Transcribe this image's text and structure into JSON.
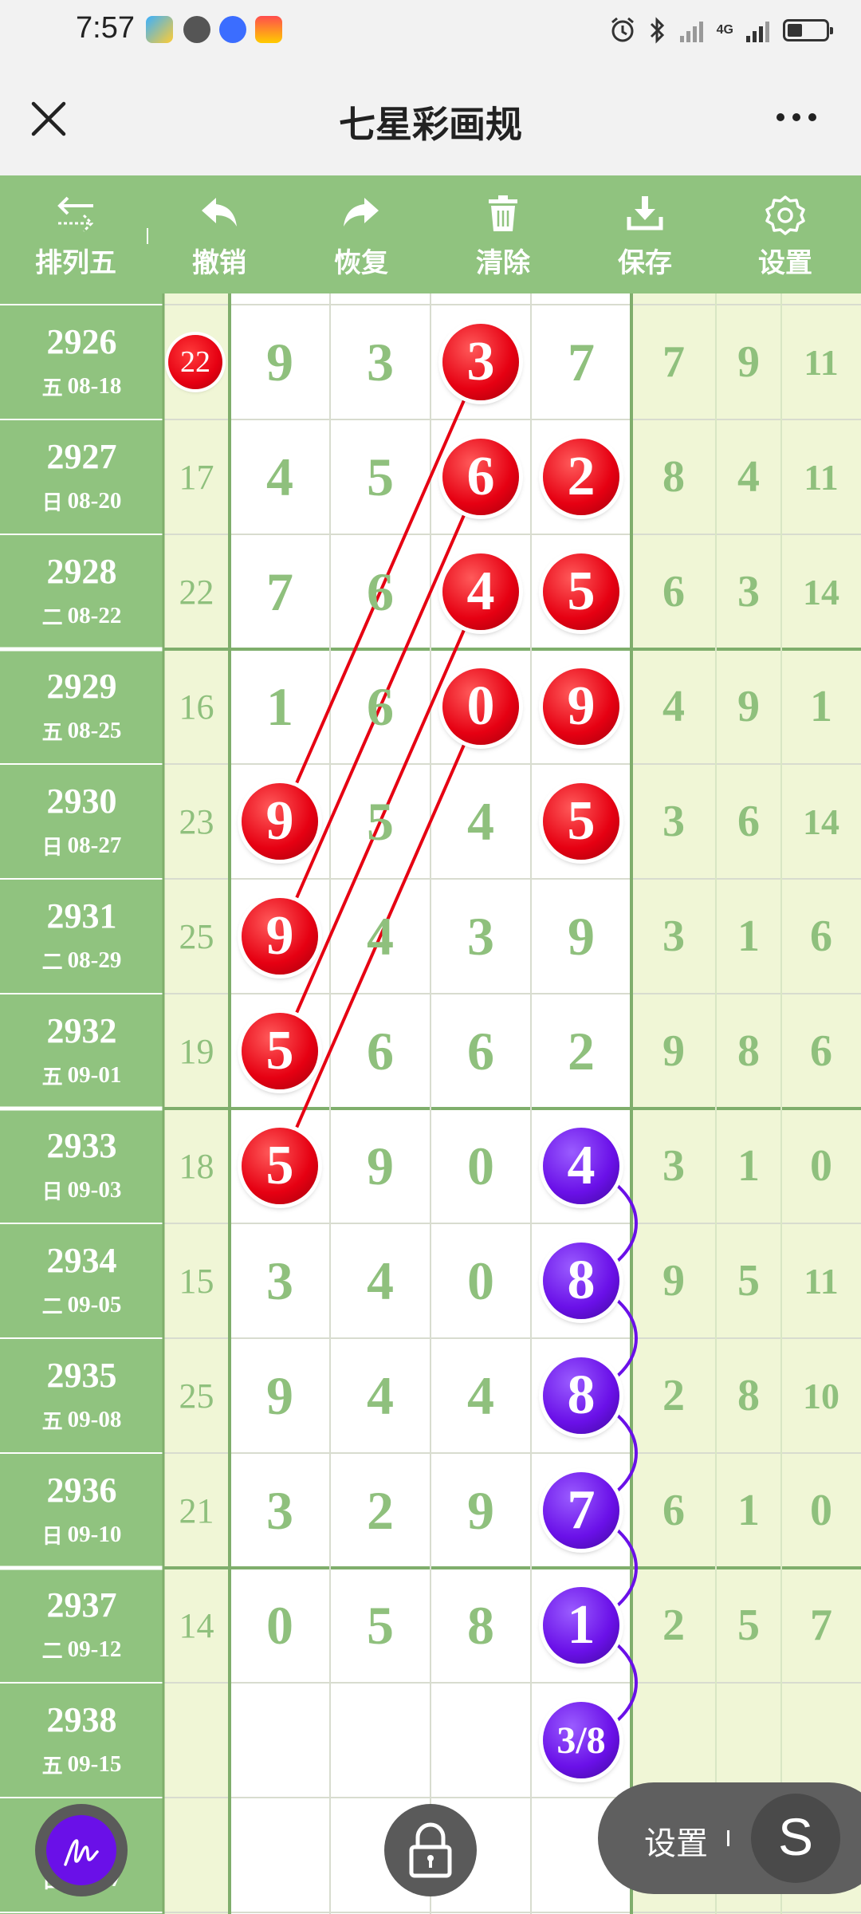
{
  "status_bar": {
    "time": "7:57",
    "network": "4G"
  },
  "header": {
    "title": "七星彩画规",
    "close_icon": "close-icon",
    "more_icon": "more-icon"
  },
  "toolbar": {
    "items": [
      {
        "label": "排列五",
        "icon": "swap-arrows-icon"
      },
      {
        "label": "撤销",
        "icon": "undo-icon"
      },
      {
        "label": "恢复",
        "icon": "redo-icon"
      },
      {
        "label": "清除",
        "icon": "trash-icon"
      },
      {
        "label": "保存",
        "icon": "download-icon"
      },
      {
        "label": "设置",
        "icon": "gear-icon"
      }
    ]
  },
  "colors": {
    "green_bar": "#90c37f",
    "pale_green": "#f0f6d6",
    "number_green": "#8fc07d",
    "red_ball": "#e60012",
    "purple_ball": "#6a10e8"
  },
  "rows": [
    {
      "issue": "2926",
      "day": "五",
      "date": "08-18",
      "sum": "22",
      "sum_circled": true,
      "digits": [
        "9",
        "3",
        "3",
        "7"
      ],
      "extras": [
        "7",
        "9",
        "11"
      ]
    },
    {
      "issue": "2927",
      "day": "日",
      "date": "08-20",
      "sum": "17",
      "sum_circled": false,
      "digits": [
        "4",
        "5",
        "6",
        "2"
      ],
      "extras": [
        "8",
        "4",
        "11"
      ]
    },
    {
      "issue": "2928",
      "day": "二",
      "date": "08-22",
      "sum": "22",
      "sum_circled": false,
      "digits": [
        "7",
        "6",
        "4",
        "5"
      ],
      "extras": [
        "6",
        "3",
        "14"
      ]
    },
    {
      "issue": "2929",
      "day": "五",
      "date": "08-25",
      "sum": "16",
      "sum_circled": false,
      "digits": [
        "1",
        "6",
        "0",
        "9"
      ],
      "extras": [
        "4",
        "9",
        "1"
      ]
    },
    {
      "issue": "2930",
      "day": "日",
      "date": "08-27",
      "sum": "23",
      "sum_circled": false,
      "digits": [
        "9",
        "5",
        "4",
        "5"
      ],
      "extras": [
        "3",
        "6",
        "14"
      ]
    },
    {
      "issue": "2931",
      "day": "二",
      "date": "08-29",
      "sum": "25",
      "sum_circled": false,
      "digits": [
        "9",
        "4",
        "3",
        "9"
      ],
      "extras": [
        "3",
        "1",
        "6"
      ]
    },
    {
      "issue": "2932",
      "day": "五",
      "date": "09-01",
      "sum": "19",
      "sum_circled": false,
      "digits": [
        "5",
        "6",
        "6",
        "2"
      ],
      "extras": [
        "9",
        "8",
        "6"
      ]
    },
    {
      "issue": "2933",
      "day": "日",
      "date": "09-03",
      "sum": "18",
      "sum_circled": false,
      "digits": [
        "5",
        "9",
        "0",
        "4"
      ],
      "extras": [
        "3",
        "1",
        "0"
      ]
    },
    {
      "issue": "2934",
      "day": "二",
      "date": "09-05",
      "sum": "15",
      "sum_circled": false,
      "digits": [
        "3",
        "4",
        "0",
        "8"
      ],
      "extras": [
        "9",
        "5",
        "11"
      ]
    },
    {
      "issue": "2935",
      "day": "五",
      "date": "09-08",
      "sum": "25",
      "sum_circled": false,
      "digits": [
        "9",
        "4",
        "4",
        "8"
      ],
      "extras": [
        "2",
        "8",
        "10"
      ]
    },
    {
      "issue": "2936",
      "day": "日",
      "date": "09-10",
      "sum": "21",
      "sum_circled": false,
      "digits": [
        "3",
        "2",
        "9",
        "7"
      ],
      "extras": [
        "6",
        "1",
        "0"
      ]
    },
    {
      "issue": "2937",
      "day": "二",
      "date": "09-12",
      "sum": "14",
      "sum_circled": false,
      "digits": [
        "0",
        "5",
        "8",
        "1"
      ],
      "extras": [
        "2",
        "5",
        "7"
      ]
    },
    {
      "issue": "2938",
      "day": "五",
      "date": "09-15",
      "sum": "",
      "sum_circled": false,
      "digits": [
        "",
        "",
        "",
        "3/8"
      ],
      "extras": [
        "",
        "",
        ""
      ]
    },
    {
      "issue": "",
      "day": "日",
      "date": "09-17",
      "sum": "",
      "sum_circled": false,
      "digits": [
        "",
        "",
        "",
        ""
      ],
      "extras": [
        "",
        "",
        ""
      ]
    }
  ],
  "red_balls": [
    {
      "row": 0,
      "col": 2,
      "label": "3"
    },
    {
      "row": 1,
      "col": 2,
      "label": "6"
    },
    {
      "row": 1,
      "col": 3,
      "label": "2"
    },
    {
      "row": 2,
      "col": 2,
      "label": "4"
    },
    {
      "row": 2,
      "col": 3,
      "label": "5"
    },
    {
      "row": 3,
      "col": 2,
      "label": "0"
    },
    {
      "row": 3,
      "col": 3,
      "label": "9"
    },
    {
      "row": 4,
      "col": 0,
      "label": "9"
    },
    {
      "row": 4,
      "col": 3,
      "label": "5"
    },
    {
      "row": 5,
      "col": 0,
      "label": "9"
    },
    {
      "row": 6,
      "col": 0,
      "label": "5"
    },
    {
      "row": 7,
      "col": 0,
      "label": "5"
    }
  ],
  "purple_balls": [
    {
      "row": 7,
      "col": 3,
      "label": "4"
    },
    {
      "row": 8,
      "col": 3,
      "label": "8"
    },
    {
      "row": 9,
      "col": 3,
      "label": "8"
    },
    {
      "row": 10,
      "col": 3,
      "label": "7"
    },
    {
      "row": 11,
      "col": 3,
      "label": "1"
    },
    {
      "row": 12,
      "col": 3,
      "label": "3/8"
    }
  ],
  "red_lines": [
    {
      "from": [
        0,
        2
      ],
      "to": [
        4,
        0
      ]
    },
    {
      "from": [
        1,
        2
      ],
      "to": [
        5,
        0
      ]
    },
    {
      "from": [
        2,
        2
      ],
      "to": [
        6,
        0
      ]
    },
    {
      "from": [
        3,
        2
      ],
      "to": [
        7,
        0
      ]
    }
  ],
  "controls": {
    "pen_icon": "pen-icon",
    "lock_icon": "lock-icon",
    "settings_label": "设置",
    "s_button_label": "S"
  }
}
